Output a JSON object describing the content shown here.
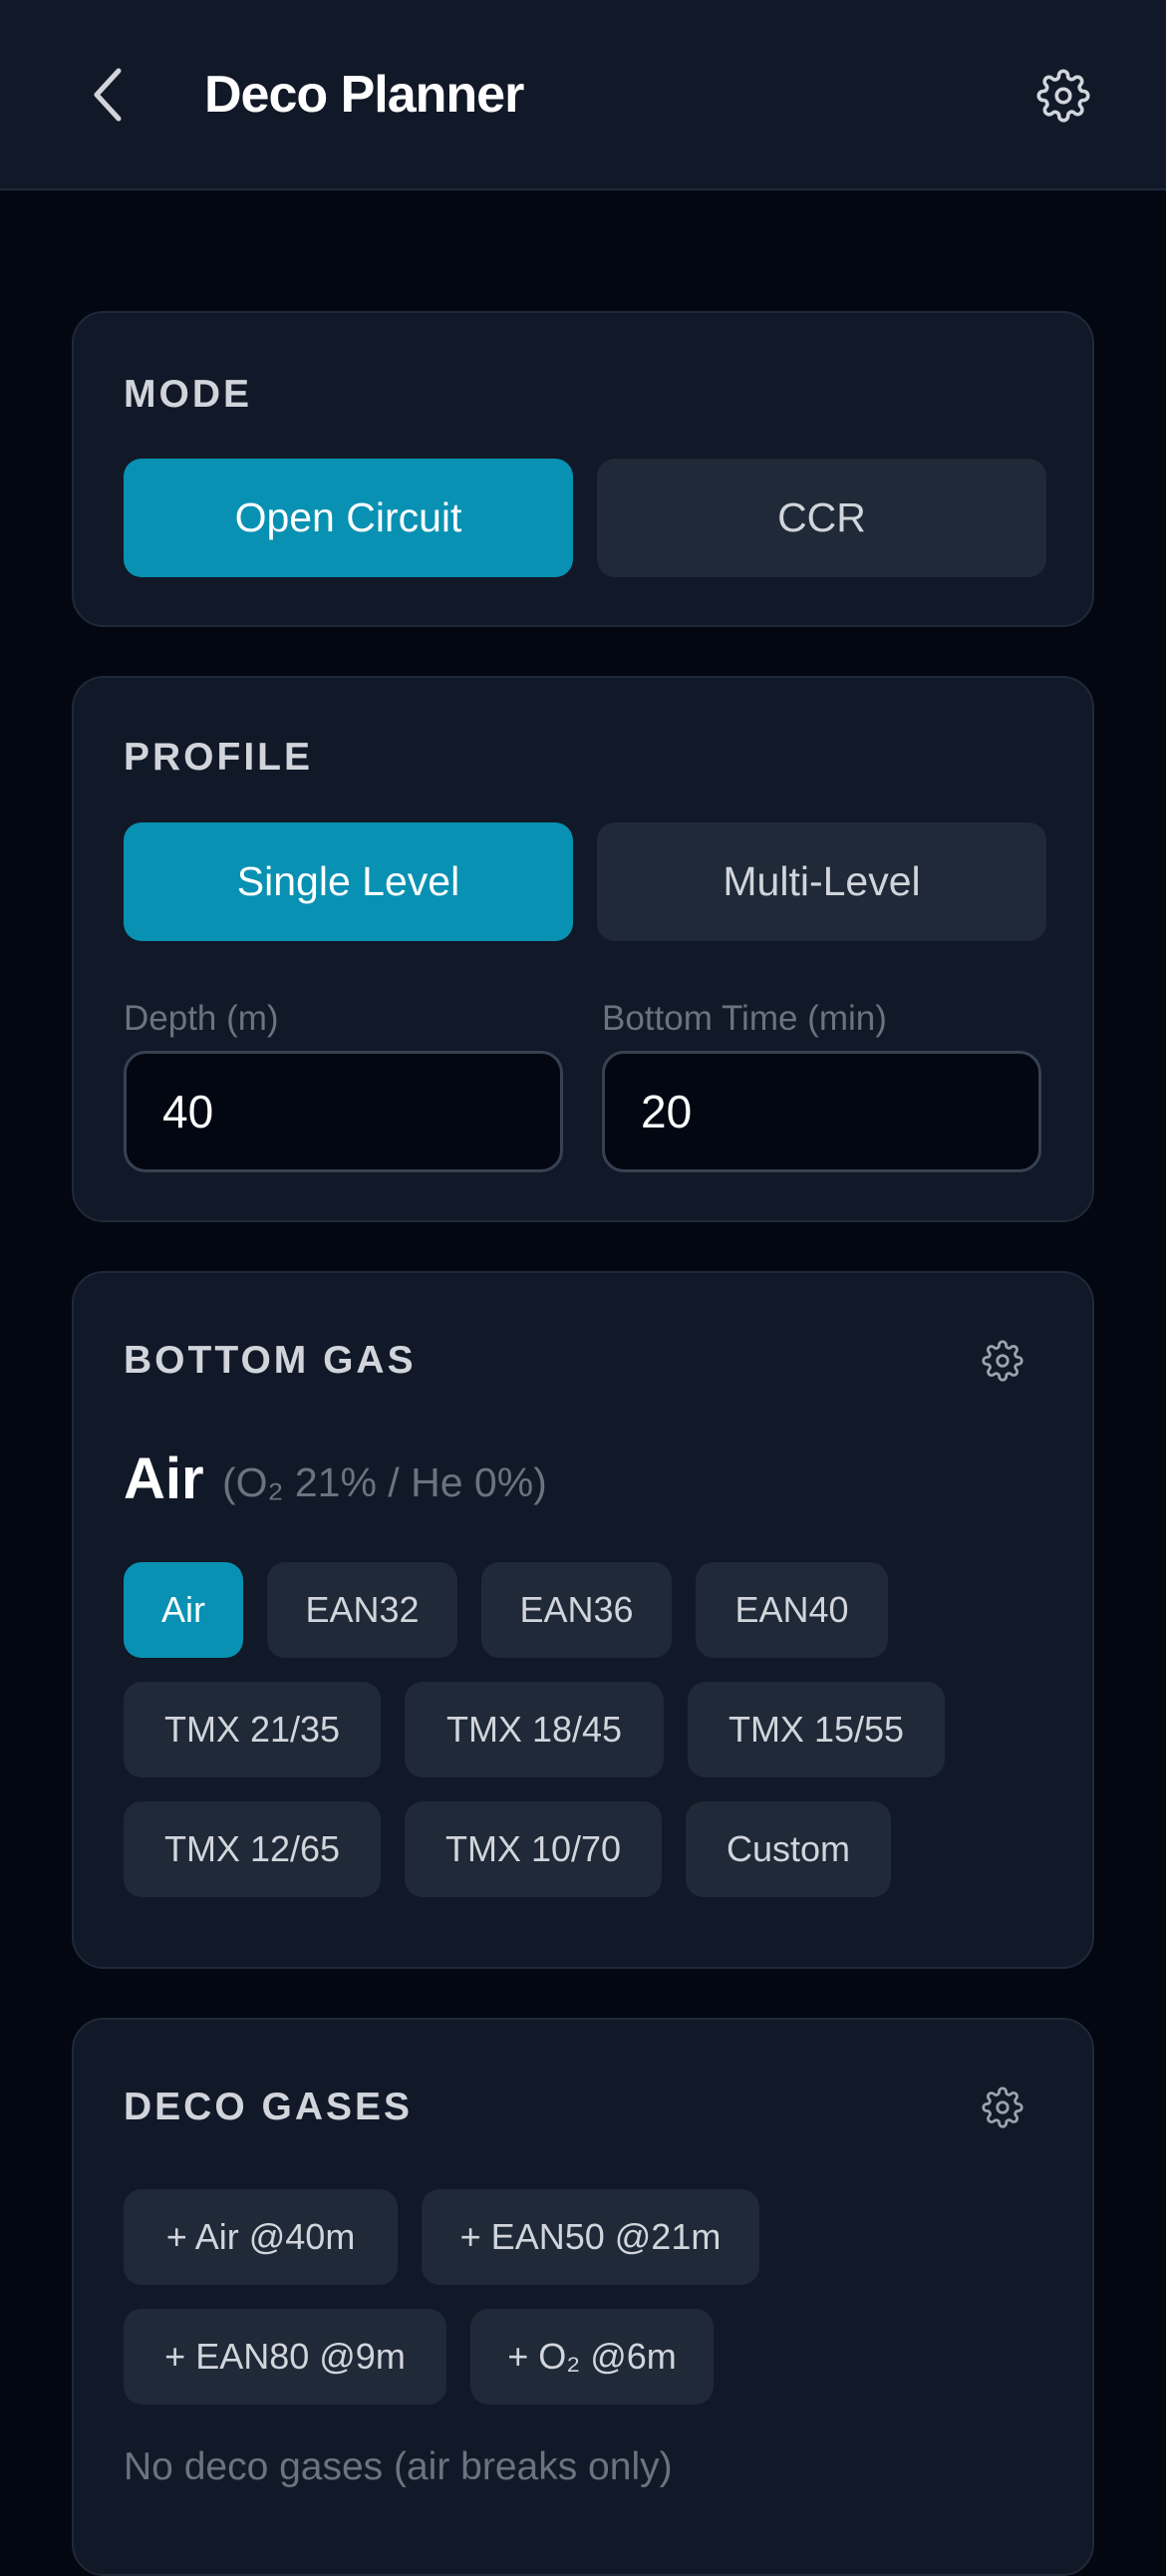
{
  "header": {
    "title": "Deco Planner",
    "back_icon": "chevron-left-icon",
    "settings_icon": "gear-icon"
  },
  "mode": {
    "title": "MODE",
    "options": [
      {
        "label": "Open Circuit",
        "selected": true
      },
      {
        "label": "CCR",
        "selected": false
      }
    ]
  },
  "profile": {
    "title": "PROFILE",
    "options": [
      {
        "label": "Single Level",
        "selected": true
      },
      {
        "label": "Multi-Level",
        "selected": false
      }
    ],
    "depth_label": "Depth (m)",
    "depth_value": "40",
    "time_label": "Bottom Time (min)",
    "time_value": "20"
  },
  "bottom_gas": {
    "title": "BOTTOM GAS",
    "current_name": "Air",
    "current_detail": "(O₂ 21% / He 0%)",
    "options": [
      {
        "label": "Air",
        "selected": true
      },
      {
        "label": "EAN32",
        "selected": false
      },
      {
        "label": "EAN36",
        "selected": false
      },
      {
        "label": "EAN40",
        "selected": false
      },
      {
        "label": "TMX 21/35",
        "selected": false
      },
      {
        "label": "TMX 18/45",
        "selected": false
      },
      {
        "label": "TMX 15/55",
        "selected": false
      },
      {
        "label": "TMX 12/65",
        "selected": false
      },
      {
        "label": "TMX 10/70",
        "selected": false
      },
      {
        "label": "Custom",
        "selected": false
      }
    ]
  },
  "deco_gases": {
    "title": "DECO GASES",
    "options": [
      {
        "label": "+ Air @40m"
      },
      {
        "label": "+ EAN50 @21m"
      },
      {
        "label": "+ EAN80 @9m"
      },
      {
        "label": "+ O₂ @6m"
      }
    ],
    "note": "No deco gases (air breaks only)"
  },
  "colors": {
    "background": "#030712",
    "card": "#111827",
    "accent": "#0891b2",
    "button": "#1f2937"
  }
}
